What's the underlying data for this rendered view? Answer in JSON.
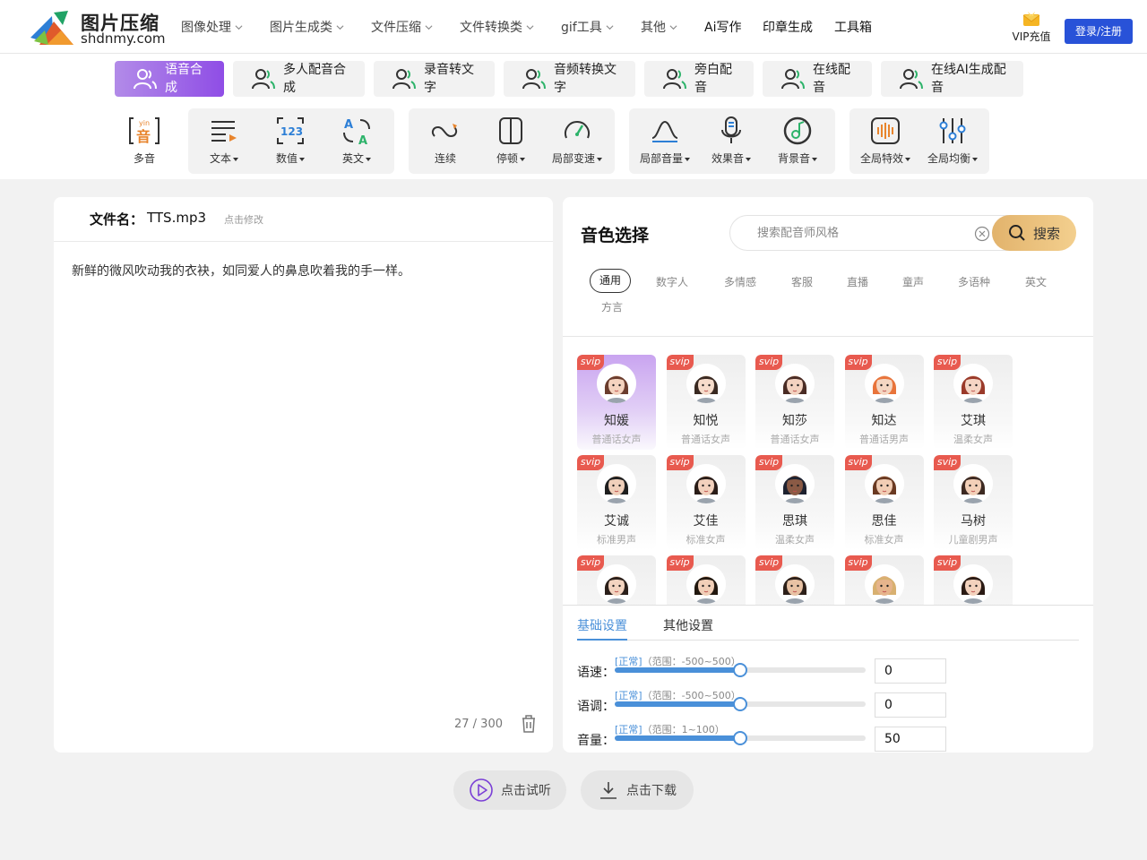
{
  "header": {
    "logo_title": "图片压缩",
    "logo_sub": "shdnmy.com",
    "nav": [
      {
        "label": "图像处理",
        "dropdown": true
      },
      {
        "label": "图片生成类",
        "dropdown": true
      },
      {
        "label": "文件压缩",
        "dropdown": true
      },
      {
        "label": "文件转换类",
        "dropdown": true
      },
      {
        "label": "gif工具",
        "dropdown": true
      },
      {
        "label": "其他",
        "dropdown": true
      },
      {
        "label": "Ai写作",
        "dropdown": false
      },
      {
        "label": "印章生成",
        "dropdown": false
      },
      {
        "label": "工具箱",
        "dropdown": false
      }
    ],
    "vip_label": "VIP充值",
    "login_label": "登录/注册"
  },
  "feature_tabs": [
    {
      "label": "语音合成",
      "active": true
    },
    {
      "label": "多人配音合成",
      "active": false
    },
    {
      "label": "录音转文字",
      "active": false
    },
    {
      "label": "音频转换文字",
      "active": false
    },
    {
      "label": "旁白配音",
      "active": false
    },
    {
      "label": "在线配音",
      "active": false
    },
    {
      "label": "在线AI生成配音",
      "active": false
    }
  ],
  "toolbar": [
    {
      "label": "多音",
      "icon": "polyphone-icon",
      "dropdown": false
    },
    {
      "label": "文本",
      "icon": "text-icon",
      "dropdown": true
    },
    {
      "label": "数值",
      "icon": "number-icon",
      "dropdown": true
    },
    {
      "label": "英文",
      "icon": "english-icon",
      "dropdown": true
    },
    {
      "label": "连续",
      "icon": "continuous-icon",
      "dropdown": false
    },
    {
      "label": "停顿",
      "icon": "pause-icon",
      "dropdown": true
    },
    {
      "label": "局部变速",
      "icon": "speed-icon",
      "dropdown": true
    },
    {
      "label": "局部音量",
      "icon": "volume-curve-icon",
      "dropdown": true
    },
    {
      "label": "效果音",
      "icon": "microphone-icon",
      "dropdown": true
    },
    {
      "label": "背景音",
      "icon": "music-note-icon",
      "dropdown": true
    },
    {
      "label": "全局特效",
      "icon": "waveform-icon",
      "dropdown": true
    },
    {
      "label": "全局均衡",
      "icon": "equalizer-icon",
      "dropdown": true
    }
  ],
  "editor": {
    "filename_label": "文件名：",
    "filename": "TTS.mp3",
    "edit_hint": "点击修改",
    "text": "新鲜的微风吹动我的衣袂，如同爱人的鼻息吹着我的手一样。",
    "counter": "27 / 300"
  },
  "voice": {
    "title": "音色选择",
    "search_placeholder": "搜索配音师风格",
    "search_button": "搜索",
    "categories": [
      "通用",
      "数字人",
      "多情感",
      "客服",
      "直播",
      "童声",
      "多语种",
      "英文",
      "方言"
    ],
    "selected_category": "通用",
    "badge": "svip",
    "cards": [
      {
        "name": "知媛",
        "desc": "普通话女声",
        "active": true,
        "hair": "#6b3d2e",
        "skin": "#f4d3bf"
      },
      {
        "name": "知悦",
        "desc": "普通话女声",
        "active": false,
        "hair": "#3a2a22",
        "skin": "#f6dccb"
      },
      {
        "name": "知莎",
        "desc": "普通话女声",
        "active": false,
        "hair": "#4a2c25",
        "skin": "#f3d2c0"
      },
      {
        "name": "知达",
        "desc": "普通话男声",
        "active": false,
        "hair": "#e8743b",
        "skin": "#f4d6c2"
      },
      {
        "name": "艾琪",
        "desc": "温柔女声",
        "active": false,
        "hair": "#9a3a2a",
        "skin": "#f5d5c4"
      },
      {
        "name": "艾诚",
        "desc": "标准男声",
        "active": false,
        "hair": "#1f1f1f",
        "skin": "#f0d0bb"
      },
      {
        "name": "艾佳",
        "desc": "标准女声",
        "active": false,
        "hair": "#2a1d18",
        "skin": "#f2d1bd"
      },
      {
        "name": "思琪",
        "desc": "温柔女声",
        "active": false,
        "hair": "#1e2230",
        "skin": "#8a5a45"
      },
      {
        "name": "思佳",
        "desc": "标准女声",
        "active": false,
        "hair": "#6a3a22",
        "skin": "#f1cdb4"
      },
      {
        "name": "马树",
        "desc": "儿童剧男声",
        "active": false,
        "hair": "#3d2a22",
        "skin": "#f3d0b8"
      },
      {
        "name": "",
        "desc": "",
        "active": false,
        "hair": "#2b1f1a",
        "skin": "#f3d4c0"
      },
      {
        "name": "",
        "desc": "",
        "active": false,
        "hair": "#22180f",
        "skin": "#f1cfb8"
      },
      {
        "name": "",
        "desc": "",
        "active": false,
        "hair": "#2d2019",
        "skin": "#e8c2a4"
      },
      {
        "name": "",
        "desc": "",
        "active": false,
        "hair": "#d8b070",
        "skin": "#e6b48c"
      },
      {
        "name": "",
        "desc": "",
        "active": false,
        "hair": "#2a1a14",
        "skin": "#f3d2bd"
      }
    ]
  },
  "settings": {
    "tabs": [
      "基础设置",
      "其他设置"
    ],
    "active_tab": "基础设置",
    "sliders": [
      {
        "label": "语速：",
        "status": "[正常]",
        "range": "（范围：-500~500）",
        "value": "0",
        "fraction": 0.5
      },
      {
        "label": "语调：",
        "status": "[正常]",
        "range": "（范围：-500~500）",
        "value": "0",
        "fraction": 0.5
      },
      {
        "label": "音量：",
        "status": "[正常]",
        "range": "（范围：1~100）",
        "value": "50",
        "fraction": 0.5
      }
    ]
  },
  "actions": {
    "listen": "点击试听",
    "download": "点击下载"
  },
  "colors": {
    "accent": "#4a90d9",
    "login": "#2852d8",
    "active_tab": "#8f4de6",
    "badge": "#e85a4f"
  }
}
